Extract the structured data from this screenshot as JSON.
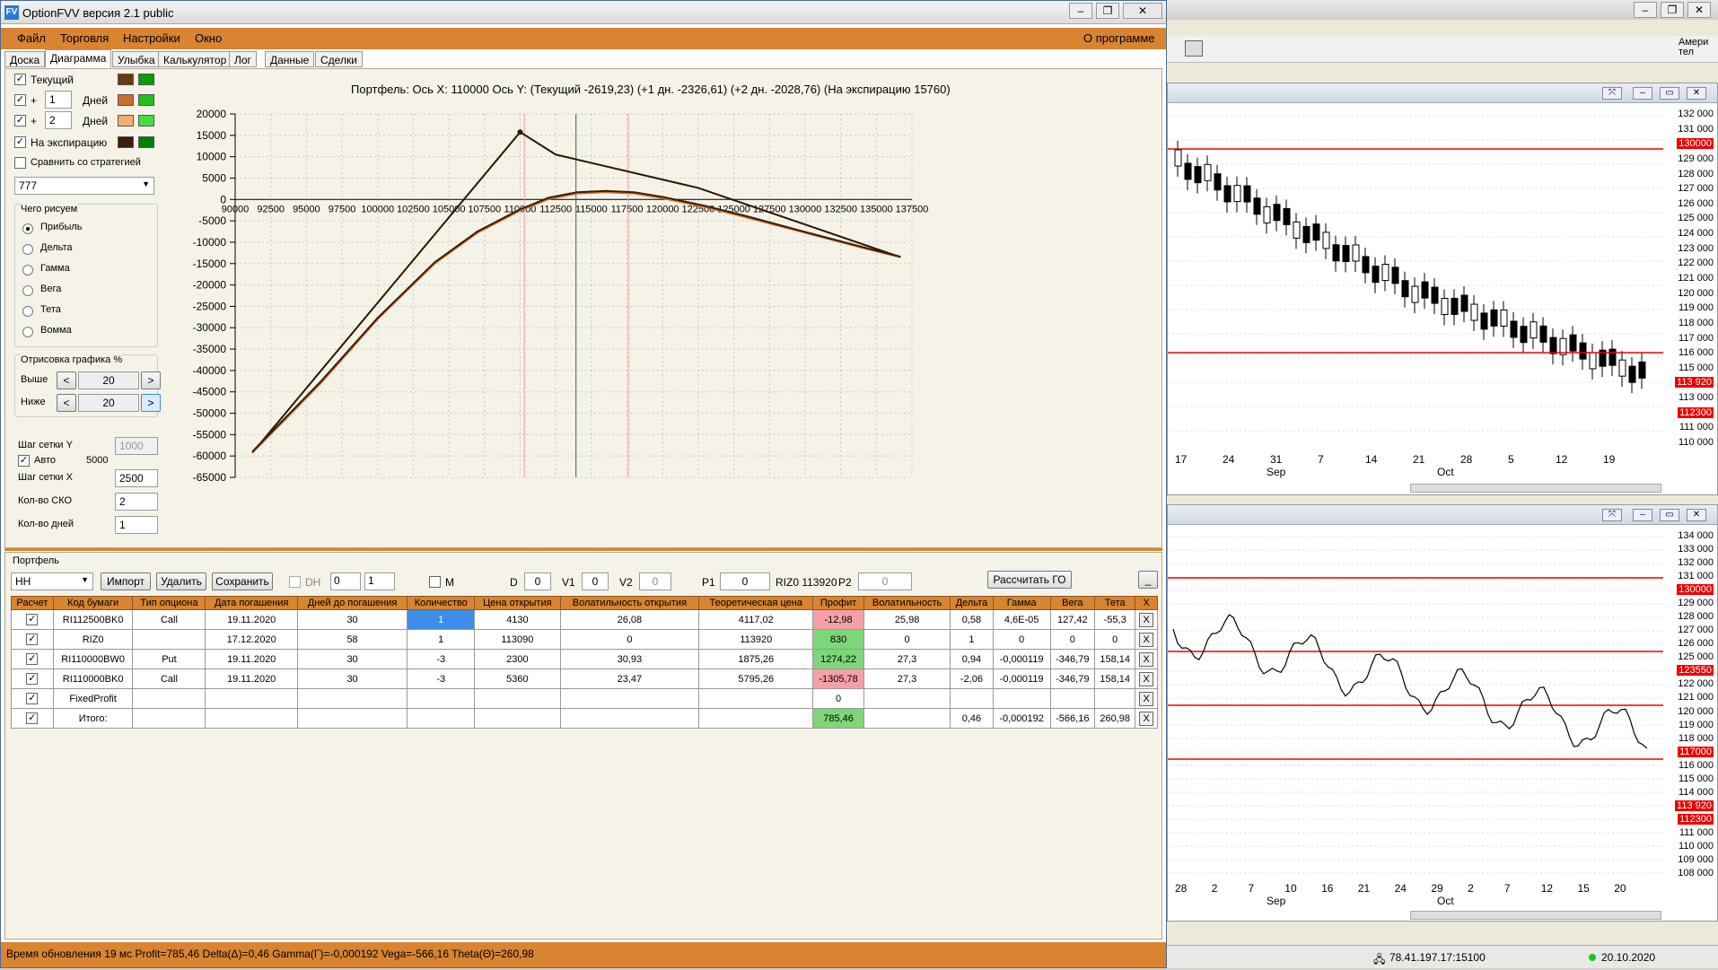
{
  "window": {
    "title": "OptionFVV версия 2.1 public",
    "app_icon": "FV"
  },
  "menu": {
    "file": "Файл",
    "trade": "Торговля",
    "settings": "Настройки",
    "window": "Окно",
    "about": "О программе"
  },
  "tabs": [
    "Доска",
    "Диаграмма",
    "Улыбка",
    "Калькулятор",
    "Лог",
    "Данные",
    "Сделки"
  ],
  "left": {
    "current": "Текущий",
    "plus": "+",
    "days1": "1",
    "days2": "2",
    "days_label": "Дней",
    "expiry": "На экспирацию",
    "compare": "Сравнить со стратегией",
    "strategy": "777",
    "draw_group": "Чего рисуем",
    "draw_options": [
      "Прибыль",
      "Дельта",
      "Гамма",
      "Вега",
      "Тета",
      "Вомма"
    ],
    "render_group": "Отрисовка графика %",
    "above": "Выше",
    "below": "Ниже",
    "above_val": "20",
    "below_val": "20",
    "grid_y": "Шаг сетки Y",
    "grid_y_val": "1000",
    "auto": "Авто",
    "auto_val": "5000",
    "grid_x": "Шаг сетки X",
    "grid_x_val": "2500",
    "sko": "Кол-во СКО",
    "sko_val": "2",
    "days": "Кол-во дней",
    "days_val": "1",
    "colors": {
      "cur1": "#6b3a10",
      "cur2": "#00a000",
      "d1a": "#c87030",
      "d1b": "#20c020",
      "d2a": "#f0b070",
      "d2b": "#40e040",
      "expa": "#3a1e08",
      "expb": "#008000"
    }
  },
  "chart_header": "Портфель: Ось X: 110000 Ось Y:  (Текущий -2619,23)  (+1 дн. -2326,61)  (+2 дн. -2028,76)  (На экспирацию 15760)",
  "chart_data": {
    "type": "line",
    "xlim": [
      90000,
      137500
    ],
    "ylim": [
      -65000,
      20000
    ],
    "xticks": [
      "90000",
      "92500",
      "95000",
      "97500",
      "100000",
      "102500",
      "105000",
      "107500",
      "110000",
      "112500",
      "115000",
      "117500",
      "120000",
      "122500",
      "125000",
      "127500",
      "130000",
      "132500",
      "135000",
      "137500"
    ],
    "yticks": [
      "20000",
      "15000",
      "10000",
      "5000",
      "0",
      "-5000",
      "-10000",
      "-15000",
      "-20000",
      "-25000",
      "-30000",
      "-35000",
      "-40000",
      "-45000",
      "-50000",
      "-55000",
      "-60000",
      "-65000"
    ],
    "vlines": [
      {
        "x": 110300,
        "color": "#f0a0a0"
      },
      {
        "x": 113920,
        "color": "#406040"
      },
      {
        "x": 117600,
        "color": "#f0a0a0"
      }
    ],
    "series": [
      {
        "color": "#2a1608",
        "x": [
          91200,
          110000,
          112500,
          122500,
          136700
        ],
        "y": [
          -59300,
          15760,
          10500,
          2700,
          -13500
        ]
      },
      {
        "color": "#c87030",
        "x": [
          91200,
          96000,
          100000,
          104000,
          107000,
          110000,
          112000,
          114000,
          116000,
          118000,
          120000,
          123000,
          126000,
          130000,
          134000,
          136700
        ],
        "y": [
          -59300,
          -43000,
          -28000,
          -15000,
          -7800,
          -2600,
          100,
          1400,
          1700,
          1400,
          300,
          -1800,
          -4300,
          -7800,
          -11300,
          -13500
        ]
      },
      {
        "color": "#3a1e08",
        "x": [
          91200,
          96000,
          100000,
          104000,
          107000,
          110000,
          112000,
          114000,
          116000,
          118000,
          120000,
          123000,
          126000,
          130000,
          134000,
          136700
        ],
        "y": [
          -59000,
          -42600,
          -27700,
          -14700,
          -7500,
          -2300,
          400,
          1700,
          2000,
          1700,
          600,
          -1500,
          -4000,
          -7600,
          -11100,
          -13400
        ]
      }
    ],
    "marker": {
      "x": 110000,
      "y": 15760
    }
  },
  "portfolio": {
    "label": "Портфель",
    "name": "HH",
    "import": "Импорт",
    "delete": "Удалить",
    "save": "Сохранить",
    "dh": "DH",
    "spin1": "0",
    "spin2": "1",
    "m": "M",
    "d_label": "D",
    "d_val": "0",
    "v1_label": "V1",
    "v1_val": "0",
    "v2_label": "V2",
    "v2_val": "0",
    "p1_label": "P1",
    "p1_val": "0",
    "riz_label": "RIZ0 113920",
    "p2_label": "P2",
    "p2_val": "0",
    "calc_go": "Рассчитать ГО",
    "min_btn": "_"
  },
  "table": {
    "headers": [
      "Расчет",
      "Код бумаги",
      "Тип опциона",
      "Дата погашения",
      "Дней до погашения",
      "Количество",
      "Цена открытия",
      "Волатильность открытия",
      "Теоретическая цена",
      "Профит",
      "Волатильность",
      "Дельта",
      "Гамма",
      "Вега",
      "Тета",
      "X"
    ],
    "rows": [
      [
        "✓",
        "RI112500BK0",
        "Call",
        "19.11.2020",
        "30",
        "1",
        "4130",
        "26,08",
        "4117,02",
        "-12,98",
        "25,98",
        "0,58",
        "4,6E-05",
        "127,42",
        "-55,3",
        "X"
      ],
      [
        "✓",
        "RIZ0",
        "",
        "17.12.2020",
        "58",
        "1",
        "113090",
        "0",
        "113920",
        "830",
        "0",
        "1",
        "0",
        "0",
        "0",
        "X"
      ],
      [
        "✓",
        "RI110000BW0",
        "Put",
        "19.11.2020",
        "30",
        "-3",
        "2300",
        "30,93",
        "1875,26",
        "1274,22",
        "27,3",
        "0,94",
        "-0,000119",
        "-346,79",
        "158,14",
        "X"
      ],
      [
        "✓",
        "RI110000BK0",
        "Call",
        "19.11.2020",
        "30",
        "-3",
        "5360",
        "23,47",
        "5795,26",
        "-1305,78",
        "27,3",
        "-2,06",
        "-0,000119",
        "-346,79",
        "158,14",
        "X"
      ],
      [
        "✓",
        "FixedProfit",
        "",
        "",
        "",
        "",
        "",
        "",
        "",
        "0",
        "",
        "",
        "",
        "",
        "",
        "X"
      ],
      [
        "✓",
        "Итого:",
        "",
        "",
        "",
        "",
        "",
        "",
        "",
        "785,46",
        "",
        "0,46",
        "-0,000192",
        "-566,16",
        "260,98",
        "X"
      ]
    ],
    "profit_colors": [
      "neg",
      "pos",
      "pos",
      "neg",
      "",
      "pos"
    ]
  },
  "status": "Время обновления 19 мс  Profit=785,46 Delta(Δ)=0,46 Gamma(Γ)=-0,000192 Vega=-566,16 Theta(Θ)=260,98",
  "bg": {
    "top_axis": [
      "132 000",
      "131 000",
      "130000",
      "129 000",
      "128 000",
      "127 000",
      "126 000",
      "125 000",
      "124 000",
      "123 000",
      "122 000",
      "121 000",
      "120 000",
      "119 000",
      "118 000",
      "117 000",
      "116 000",
      "115 000",
      "113 920",
      "113 000",
      "112300",
      "111 000",
      "110 000"
    ],
    "top_dates": [
      "17",
      "24",
      "31",
      "7",
      "14",
      "21",
      "28",
      "5",
      "12",
      "19"
    ],
    "top_months": [
      "Sep",
      "Oct"
    ],
    "bot_axis": [
      "134 000",
      "133 000",
      "132 000",
      "131 000",
      "130000",
      "129 000",
      "128 000",
      "127 000",
      "126 000",
      "125 000",
      "123550",
      "122 000",
      "121 000",
      "120 000",
      "119 000",
      "118 000",
      "117000",
      "116 000",
      "115 000",
      "114 000",
      "113 920",
      "112300",
      "111 000",
      "110 000",
      "109 000",
      "108 000"
    ],
    "bot_dates": [
      "28",
      "2",
      "7",
      "10",
      "16",
      "21",
      "24",
      "29",
      "2",
      "7",
      "12",
      "15",
      "20"
    ],
    "bot_months": [
      "Sep",
      "Oct"
    ],
    "corner_text": "Амери тел",
    "ip": "78.41.197.17:15100",
    "date": "20.10.2020"
  }
}
